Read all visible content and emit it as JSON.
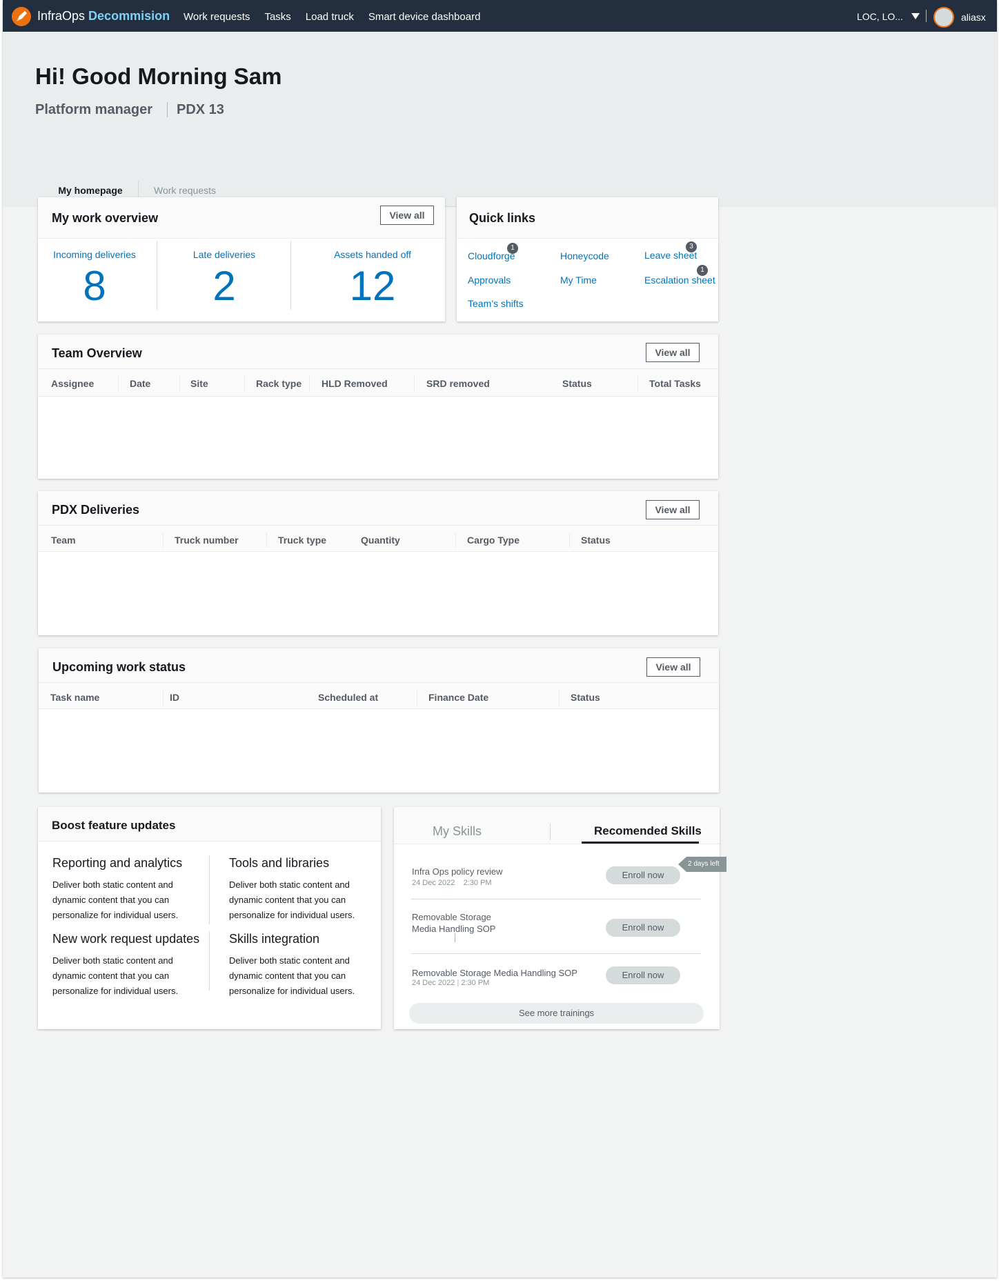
{
  "nav": {
    "brand_main": "InfraOps",
    "brand_accent": "Decommision",
    "links": [
      "Work requests",
      "Tasks",
      "Load truck",
      "Smart device dashboard"
    ],
    "location": "LOC, LO...",
    "user": "aliasx"
  },
  "header": {
    "greeting": "Hi! Good Morning Sam",
    "role": "Platform manager",
    "site": "PDX 13"
  },
  "tabs": [
    "My homepage",
    "Work requests"
  ],
  "overview": {
    "title": "My work overview",
    "view_all": "View all",
    "stats": [
      {
        "label": "Incoming deliveries",
        "value": "8"
      },
      {
        "label": "Late deliveries",
        "value": "2"
      },
      {
        "label": "Assets handed off",
        "value": "12"
      }
    ]
  },
  "quick_links": {
    "title": "Quick links",
    "items": [
      {
        "label": "Cloudforge",
        "badge": "1"
      },
      {
        "label": "Honeycode",
        "badge": ""
      },
      {
        "label": "Leave sheet",
        "badge": "3"
      },
      {
        "label": "Approvals",
        "badge": ""
      },
      {
        "label": "My Time",
        "badge": ""
      },
      {
        "label": "Escalation sheet",
        "badge": "1"
      },
      {
        "label": "Team’s  shifts",
        "badge": ""
      }
    ]
  },
  "team_overview": {
    "title": "Team Overview",
    "view_all": "View all",
    "columns": [
      "Assignee",
      "Date",
      "Site",
      "Rack type",
      "HLD Removed",
      "SRD removed",
      "Status",
      "Total Tasks"
    ]
  },
  "deliveries": {
    "title": "PDX Deliveries",
    "view_all": "View all",
    "columns": [
      "Team",
      "Truck number",
      "Truck type",
      "Quantity",
      "Cargo Type",
      "Status"
    ]
  },
  "upcoming": {
    "title": "Upcoming work status",
    "view_all": "View all",
    "columns": [
      "Task name",
      "ID",
      "Scheduled at",
      "Finance Date",
      "Status"
    ]
  },
  "boost": {
    "title": "Boost feature updates",
    "items": [
      {
        "title": "Reporting and analytics",
        "desc": "Deliver both static content and dynamic content that you can personalize for individual users."
      },
      {
        "title": "Tools and libraries",
        "desc": "Deliver both static content and dynamic content that you can personalize for individual users."
      },
      {
        "title": "New work request updates",
        "desc": "Deliver both static content and dynamic content that you can personalize for individual users."
      },
      {
        "title": "Skills integration",
        "desc": "Deliver both static content and dynamic content that you can personalize for individual users."
      }
    ]
  },
  "skills": {
    "tab_my": "My Skills",
    "tab_recommended": "Recomended Skills",
    "badge": "2 days left",
    "enroll_label": "Enroll now",
    "see_more": "See more trainings",
    "items": [
      {
        "title": "Infra Ops policy review",
        "date": "24 Dec 2022",
        "time": "2:30 PM"
      },
      {
        "title": "Removable Storage Media Handling SOP",
        "date": "",
        "time": ""
      },
      {
        "title": "Removable Storage Media Handling SOP",
        "date": "24 Dec 2022",
        "time": "2:30 PM"
      }
    ]
  },
  "colors": {
    "nav_bg": "#232f3e",
    "brand_accent": "#7fd1f6",
    "link": "#0073bb",
    "logo": "#ec7211"
  }
}
